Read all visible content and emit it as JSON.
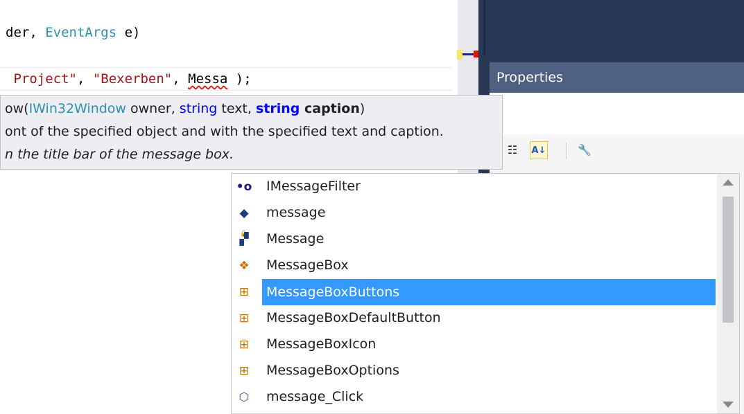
{
  "editor": {
    "line1": {
      "prefix": "der, ",
      "type": "EventArgs",
      "suffix": " e)"
    },
    "line2": {
      "str1": " Project\"",
      "sep1": ", ",
      "str2": "\"Bexerben\"",
      "sep2": ", ",
      "ident": "Messa",
      "suffix": " );"
    }
  },
  "tooltip": {
    "sig_prefix": "ow(",
    "sig_type": "IWin32Window",
    "sig_mid1": " owner, ",
    "sig_kw1": "string",
    "sig_mid2": " text, ",
    "sig_kw2": "string",
    "sig_bold": " caption",
    "sig_suffix": ")",
    "description": "ont of the specified object and with the specified text and caption.",
    "param_doc": "n the title bar of the message box."
  },
  "properties": {
    "title": "Properties",
    "toolbar": {
      "categorized_icon": "categorized-icon",
      "alphabetical_icon": "alphabetical-sort-icon",
      "property_pages_icon": "wrench-icon"
    }
  },
  "completion": {
    "items": [
      {
        "label": "IMessageFilter",
        "icon": "interface-icon",
        "glyph": "•o"
      },
      {
        "label": "message",
        "icon": "private-field-icon",
        "glyph": "◆"
      },
      {
        "label": "Message",
        "icon": "struct-icon",
        "glyph": "▞"
      },
      {
        "label": "MessageBox",
        "icon": "class-icon",
        "glyph": "❖"
      },
      {
        "label": "MessageBoxButtons",
        "icon": "enum-icon",
        "glyph": "⊞",
        "selected": true
      },
      {
        "label": "MessageBoxDefaultButton",
        "icon": "enum-icon",
        "glyph": "⊞"
      },
      {
        "label": "MessageBoxIcon",
        "icon": "enum-icon",
        "glyph": "⊞"
      },
      {
        "label": "MessageBoxOptions",
        "icon": "enum-icon",
        "glyph": "⊞"
      },
      {
        "label": "message_Click",
        "icon": "private-method-icon",
        "glyph": "⬡"
      }
    ]
  },
  "colors": {
    "selection": "#3399ff",
    "vs_chrome": "#293955",
    "properties_header": "#4d6082",
    "type_name": "#2b91af",
    "string": "#a31515",
    "keyword": "#0000ff"
  }
}
